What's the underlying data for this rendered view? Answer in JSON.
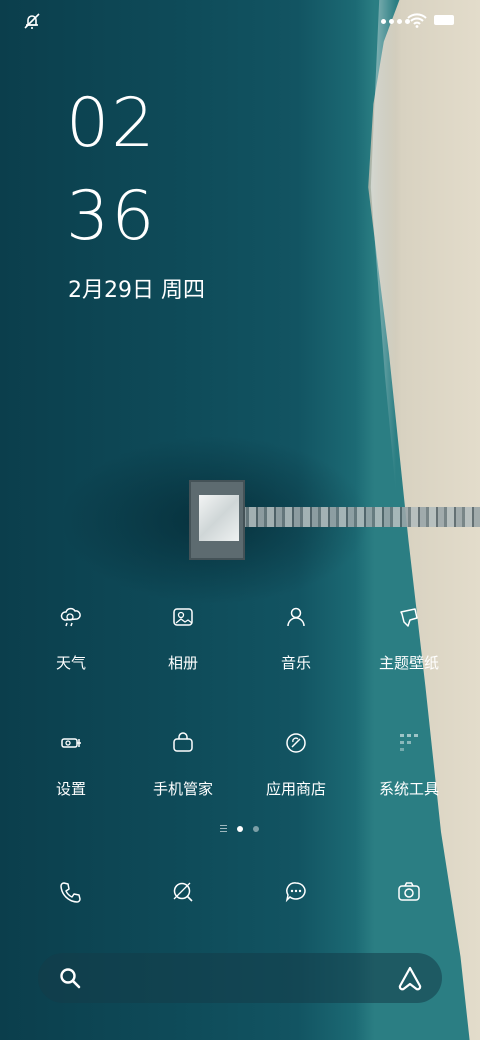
{
  "clock": {
    "hour": "02",
    "minute": "36"
  },
  "date": "2月29日 周四",
  "apps_row1": [
    {
      "label": "天气",
      "icon": "weather-icon"
    },
    {
      "label": "相册",
      "icon": "gallery-icon"
    },
    {
      "label": "音乐",
      "icon": "music-icon"
    },
    {
      "label": "主题壁纸",
      "icon": "themes-icon"
    }
  ],
  "apps_row2": [
    {
      "label": "设置",
      "icon": "settings-icon"
    },
    {
      "label": "手机管家",
      "icon": "phone-manager-icon"
    },
    {
      "label": "应用商店",
      "icon": "app-store-icon"
    },
    {
      "label": "系统工具",
      "icon": "system-tools-folder-icon"
    }
  ],
  "pager": {
    "pages": 2,
    "current_page": 1
  },
  "dock": [
    {
      "icon": "phone-icon"
    },
    {
      "icon": "browser-icon"
    },
    {
      "icon": "messages-icon"
    },
    {
      "icon": "camera-icon"
    }
  ],
  "colors": {
    "sea": "#0e4a58",
    "sand": "#e3dccb",
    "text": "#ffffff"
  }
}
